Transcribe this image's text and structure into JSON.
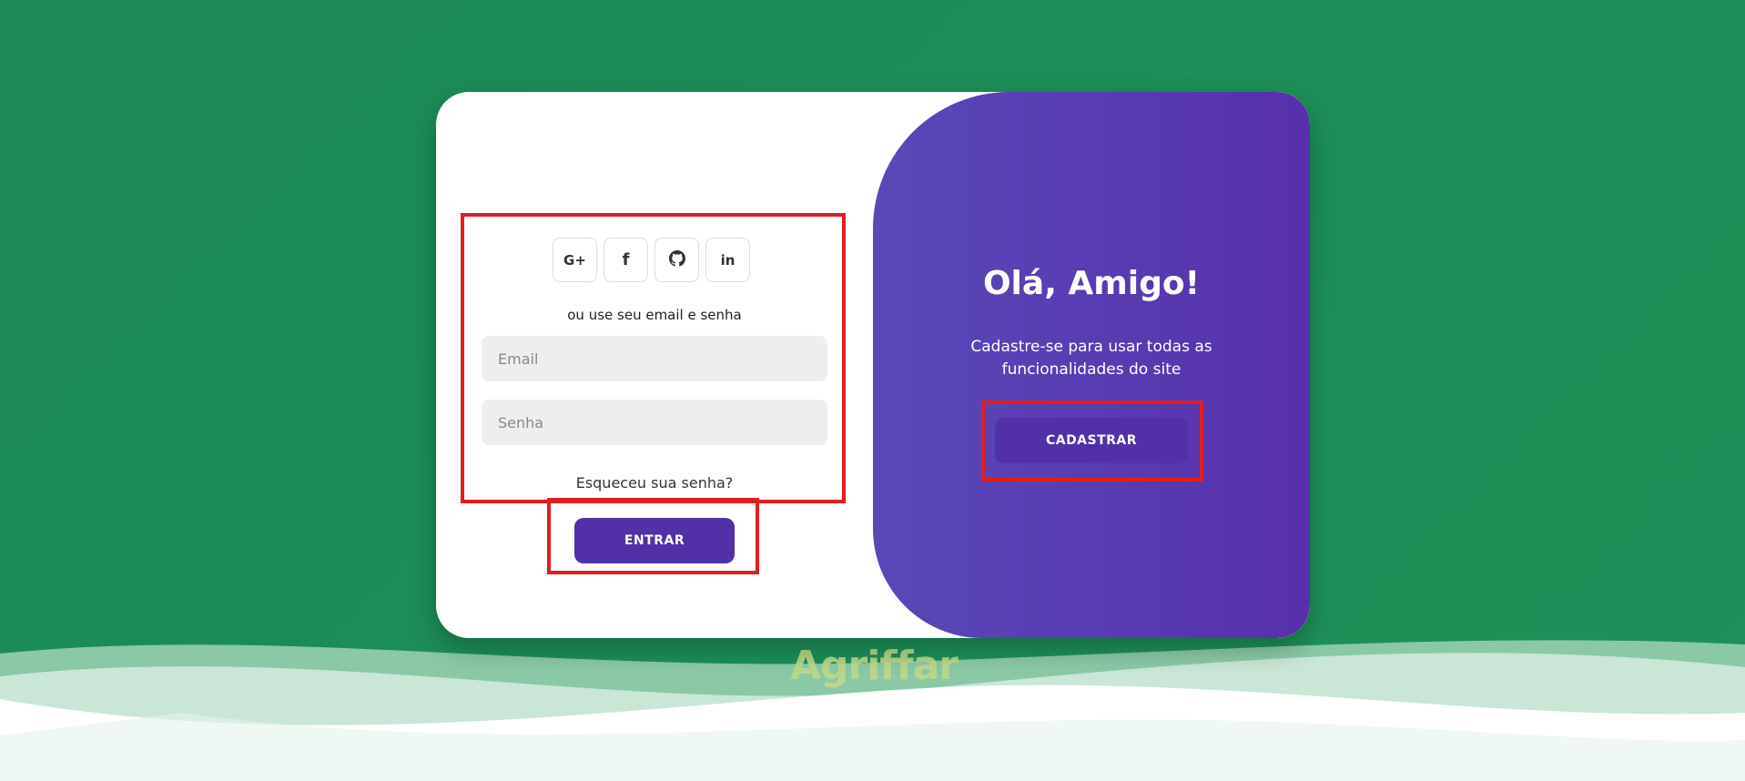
{
  "brand": {
    "name": "Agriffar"
  },
  "login": {
    "social": [
      {
        "label": "G+",
        "icon": "google-plus-icon"
      },
      {
        "label": "f",
        "icon": "facebook-icon"
      },
      {
        "label": "",
        "icon": "github-icon"
      },
      {
        "label": "in",
        "icon": "linkedin-icon"
      }
    ],
    "alt_text": "ou use seu email e senha",
    "email_placeholder": "Email",
    "password_placeholder": "Senha",
    "forgot_link": "Esqueceu sua senha?",
    "submit_label": "ENTRAR"
  },
  "signup_panel": {
    "title": "Olá, Amigo!",
    "subtitle": "Cadastre-se para usar todas as funcionalidades do site",
    "button_label": "CADASTRAR"
  },
  "colors": {
    "background": "#1c8a56",
    "accent": "#5230a8",
    "panel_gradient_start": "#5849b8",
    "panel_gradient_end": "#5730ab",
    "highlight": "#e01e1e"
  }
}
